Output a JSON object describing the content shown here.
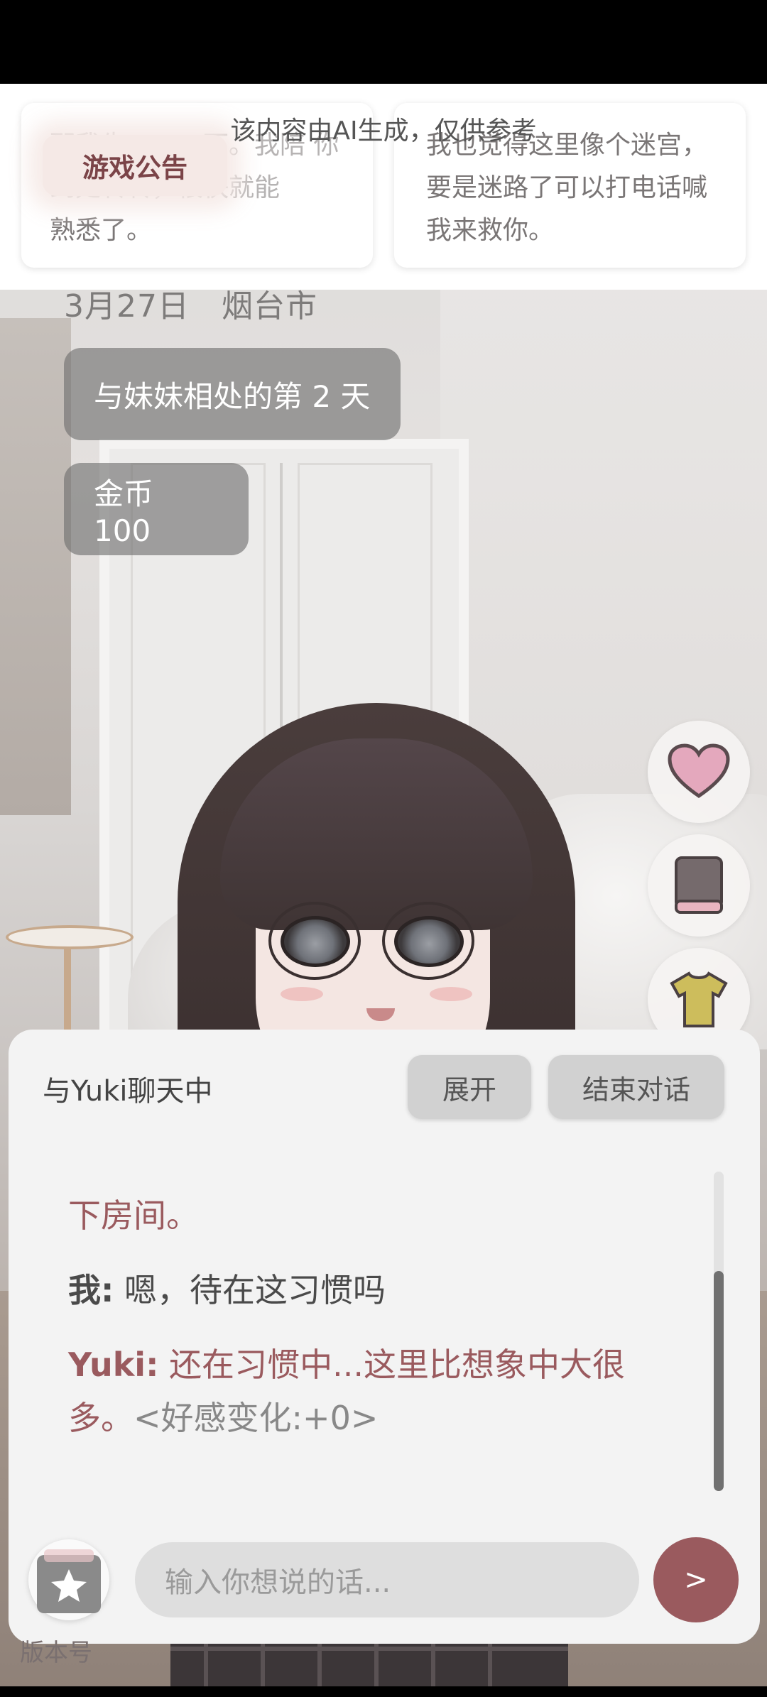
{
  "ai_notice": "该内容由AI生成，仅供参考",
  "announcement": {
    "label": "游戏公告"
  },
  "messages_preview": {
    "left_text": "熟悉了。",
    "left_faded": "那我先……一下。我陪 你到处转转，很快就能",
    "right_text": "我也觉得这里像个迷宫，要是迷路了可以打电话喊我来救你。"
  },
  "info": {
    "date_location": "3月27日　烟台市",
    "days_with_sister": "与妹妹相处的第 2 天",
    "coins": "金币 100"
  },
  "side_buttons": [
    {
      "name": "favor",
      "icon": "heart-icon",
      "color": "#e4a8bd"
    },
    {
      "name": "diary",
      "icon": "book-icon",
      "color": "#756a6c"
    },
    {
      "name": "outfit",
      "icon": "shirt-icon",
      "color": "#cdbd5c"
    }
  ],
  "chat": {
    "title": "与Yuki聊天中",
    "expand_label": "展开",
    "end_label": "结束对话",
    "lines": [
      {
        "speaker": "",
        "text": "下房间。",
        "style": "yuki"
      },
      {
        "speaker": "我:",
        "text": " 嗯，待在这习惯吗",
        "style": "me"
      },
      {
        "speaker": "Yuki:",
        "text": " 还在习惯中...这里比想象中大很多。",
        "suffix": "<好感变化:+0>",
        "style": "yuki"
      }
    ],
    "input_placeholder": "输入你想说的话...",
    "send_label": ">"
  },
  "version": "版本号",
  "colors": {
    "accent": "#9a5a5e",
    "chip_bg": "#6e6e6e",
    "panel_bg": "#f3f3f3"
  }
}
